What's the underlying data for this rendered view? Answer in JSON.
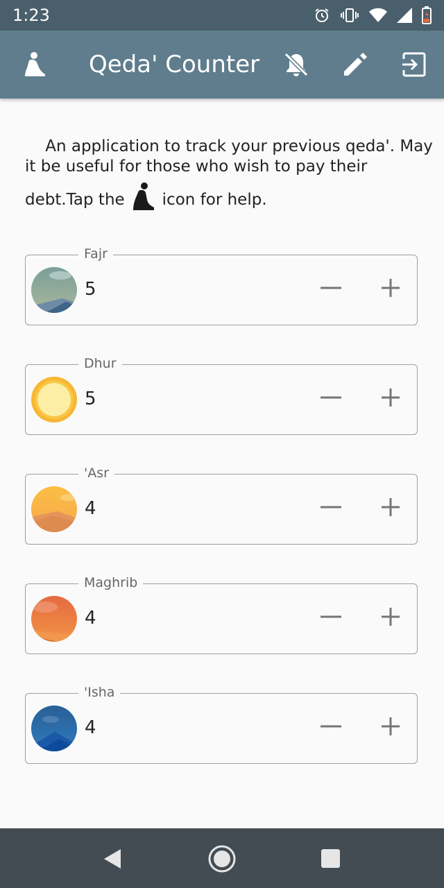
{
  "status_bar": {
    "time": "1:23",
    "icons": [
      "alarm-icon",
      "vibrate-icon",
      "wifi-icon",
      "signal-icon",
      "battery-low-icon"
    ]
  },
  "app_bar": {
    "title": "Qeda' Counter",
    "icons": [
      "prayer-person-icon",
      "notifications-off-icon",
      "edit-pencil-icon",
      "exit-icon"
    ]
  },
  "intro": {
    "line1": "    An application to track your previous qeda'. May",
    "line2": "it be useful for those who wish to pay their",
    "line3_before": "debt.Tap the",
    "line3_after": "icon for help."
  },
  "prayers": [
    {
      "name": "Fajr",
      "count": "5",
      "avatar": "fajr-dawn-avatar"
    },
    {
      "name": "Dhur",
      "count": "5",
      "avatar": "dhur-sun-avatar"
    },
    {
      "name": "'Asr",
      "count": "4",
      "avatar": "asr-afternoon-avatar"
    },
    {
      "name": "Maghrib",
      "count": "4",
      "avatar": "maghrib-sunset-avatar"
    },
    {
      "name": "'Isha",
      "count": "4",
      "avatar": "isha-night-avatar"
    }
  ],
  "nav_bar": {
    "buttons": [
      "back-icon",
      "home-icon",
      "recents-icon"
    ]
  },
  "colors": {
    "status_bar": "#4a5f6c",
    "app_bar": "#5f7d8c",
    "background": "#fafafa",
    "nav_bar": "#434c53",
    "card_border": "#9e9e9e"
  }
}
